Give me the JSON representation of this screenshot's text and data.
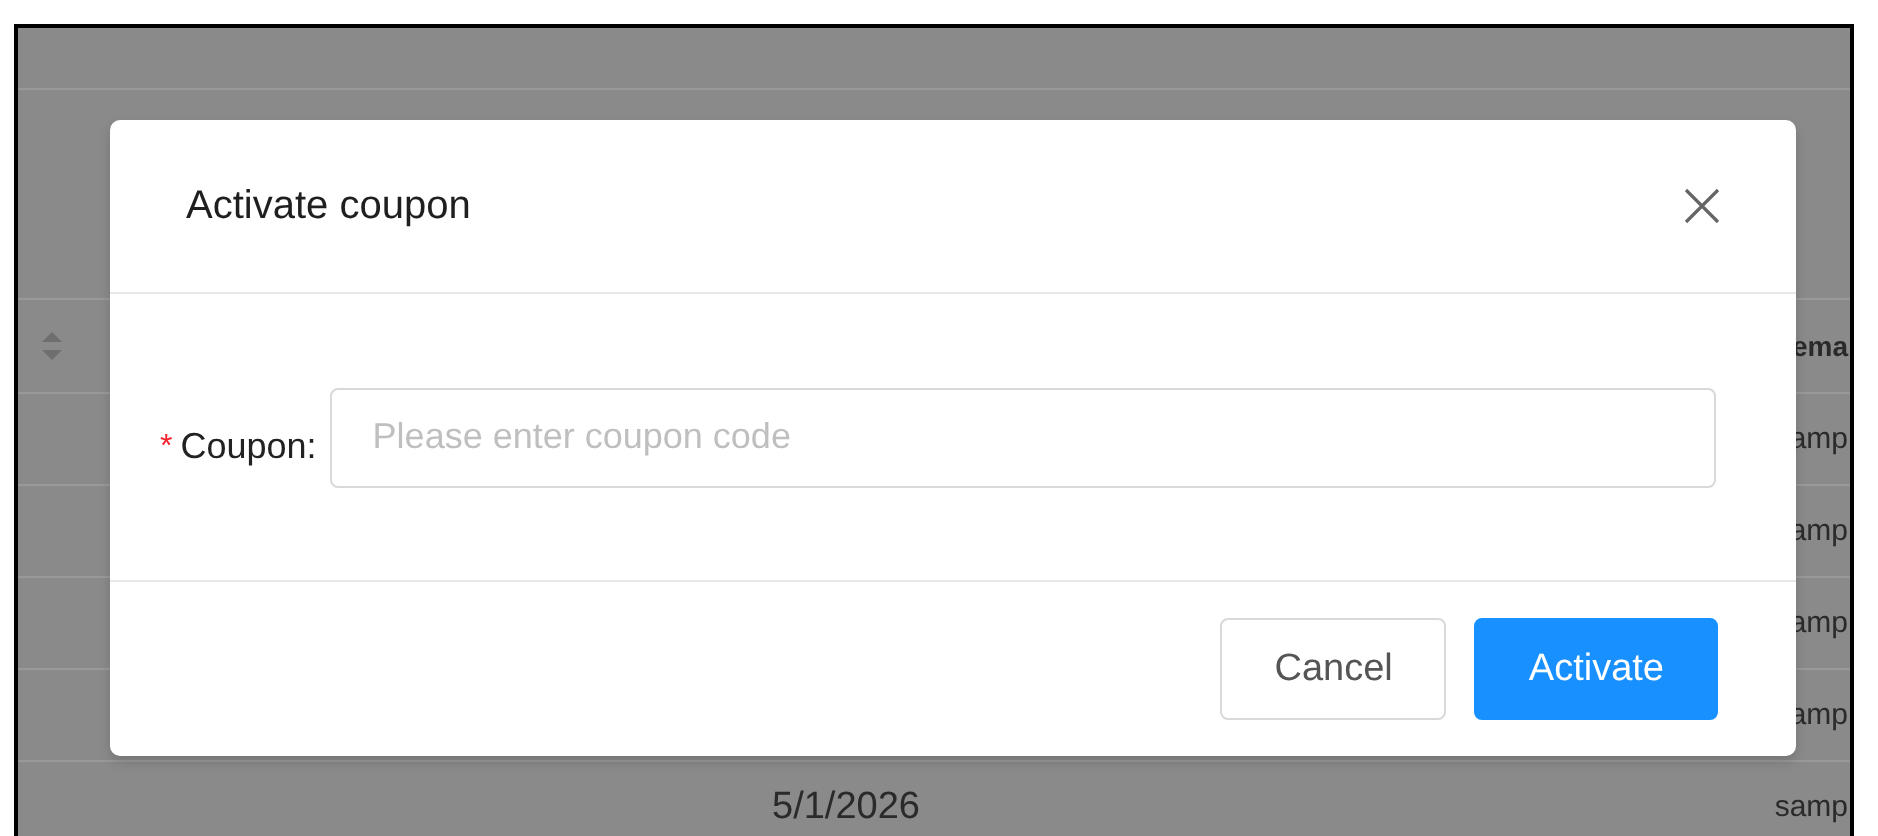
{
  "table": {
    "header": {
      "column_2": "ema"
    },
    "rows": [
      {
        "column_2": "amp"
      },
      {
        "column_2": "amp"
      },
      {
        "column_2": "amp"
      },
      {
        "column_2": "amp"
      },
      {
        "column_1": "5/1/2026",
        "column_2": "samp"
      }
    ]
  },
  "dialog": {
    "title": "Activate coupon",
    "field": {
      "required_mark": "*",
      "label": "Coupon:",
      "placeholder": "Please enter coupon code"
    },
    "buttons": [
      {
        "label": "Cancel",
        "kind": "default"
      },
      {
        "label": "Activate",
        "kind": "primary"
      }
    ]
  }
}
